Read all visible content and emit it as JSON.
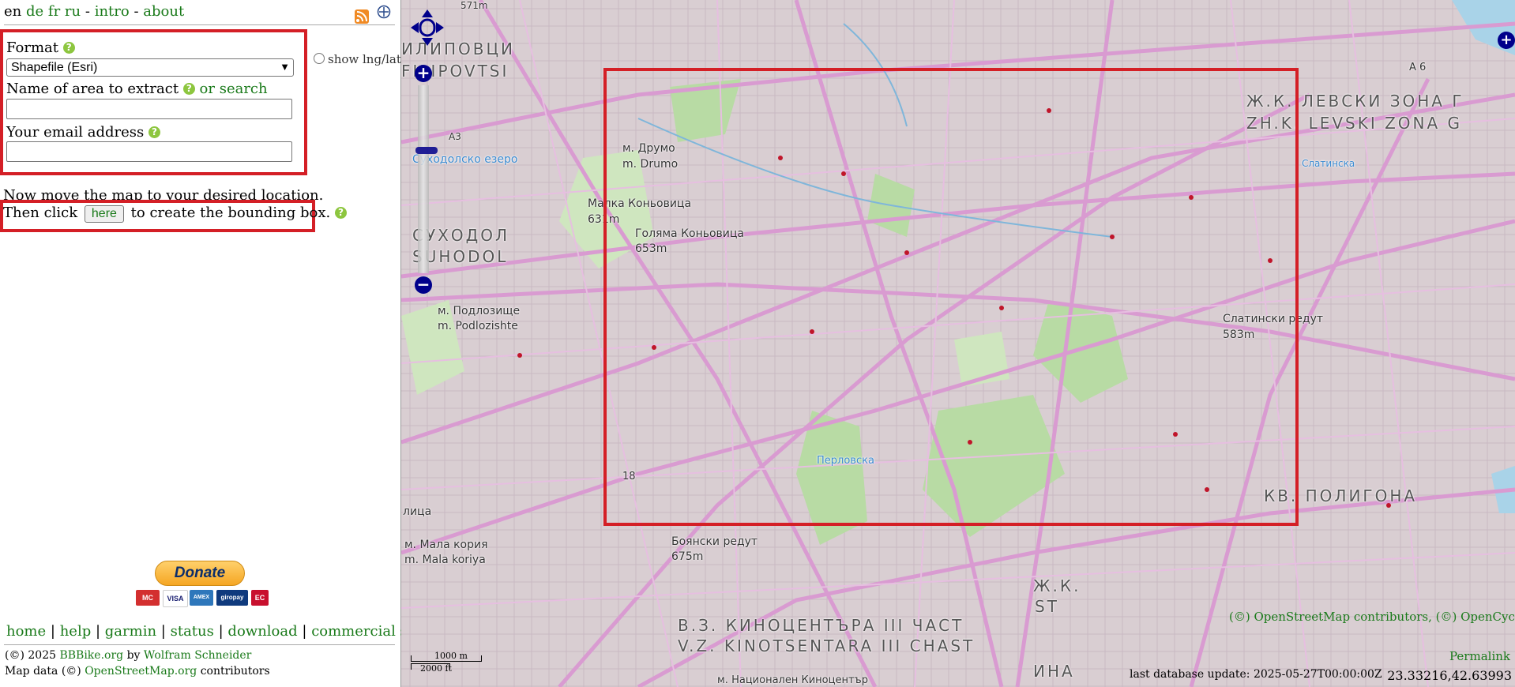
{
  "languages": {
    "current": "en",
    "links": [
      "de",
      "fr",
      "ru"
    ],
    "intro": "intro",
    "about": "about",
    "sep": "-"
  },
  "form": {
    "format_label": "Format",
    "format_selected": "Shapefile (Esri)",
    "show_lnglat": "show lng/lat",
    "area_label": "Name of area to extract",
    "or_search": "or search",
    "area_value": "",
    "email_label": "Your email address",
    "email_value": ""
  },
  "instructions": {
    "line1": "Now move the map to your desired location.",
    "line2_before": "Then click",
    "here_button": "here",
    "line2_after": "to create the bounding box."
  },
  "donate": {
    "label": "Donate",
    "cards": [
      "MC",
      "VISA",
      "AMEX",
      "giropay",
      "EC"
    ]
  },
  "footer": {
    "links": [
      "home",
      "help",
      "garmin",
      "status",
      "download",
      "commercial support"
    ],
    "sep": "|",
    "copyright_prefix": "(©) 2025",
    "site": "BBBike.org",
    "by": "by",
    "author": "Wolfram Schneider",
    "mapdata_prefix": "Map data (©)",
    "osm": "OpenStreetMap.org",
    "contributors": "contributors"
  },
  "map": {
    "labels": {
      "drumo_bg": "м. Друмо",
      "drumo_lat": "m. Drumo",
      "malka": "Малка Коньовица",
      "malka_h": "631m",
      "golyama": "Голяма Коньовица",
      "golyama_h": "653m",
      "suhodol_bg": "СУХОДОЛ",
      "suhodol_lat": "SUHODOL",
      "podlozishte_bg": "м. Подлозище",
      "podlozishte_lat": "m. Podlozishte",
      "levski_bg": "Ж.К. ЛЕВСКИ ЗОНА Г",
      "levski_lat": "ZH.K. LEVSKI ZONA G",
      "slatinski": "Слатински редут",
      "slatinski_h": "583m",
      "poligona": "КВ. ПОЛИГОНА",
      "boyanski": "Боянски редут",
      "boyanski_h": "675m",
      "malakoriya_bg": "м. Мала кория",
      "malakoriya_lat": "m. Mala koriya",
      "kinocentar_bg": "В.З. КИНОЦЕНТЪРА III ЧАСТ",
      "kinocentar_lat": "V.Z. KINOTSENTARA III CHAST",
      "iliyantsi_bg": "ИЛИПОВЦИ",
      "iliyantsi_lat": "FILIPOVTSI",
      "suhodolsko": "Суходолско езеро",
      "natsionalen": "м. Национален Киноцентър",
      "a6": "A 6",
      "a3": "A3",
      "r18": "18",
      "zhk": "Ж.К.",
      "st": "ST",
      "ina": "ИНА",
      "litsa": "лица",
      "perlovska": "Перловска",
      "slatinska": "Слатинска",
      "elevation_top": "571m"
    },
    "attribution": "(©) OpenStreetMap contributors, (©) OpenCycleMap",
    "permalink": "Permalink",
    "db_update": "last database update: 2025-05-27T00:00:00Z",
    "coords": "23.33216,42.63993",
    "scale_m": "1000 m",
    "scale_ft": "2000 ft",
    "colors": {
      "bbox": "#d41f26",
      "roads": "#d99bd1",
      "park": "#b8dba4",
      "nav": "#00008b",
      "link": "#1a7a1a"
    }
  }
}
